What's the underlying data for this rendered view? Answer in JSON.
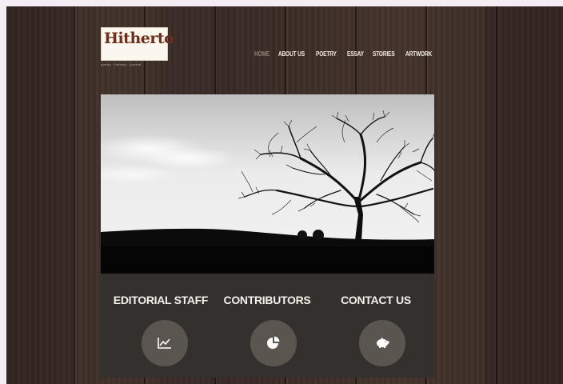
{
  "brand": {
    "logo_text": "Hitherto",
    "tagline": "poetry · literary · journal"
  },
  "nav": {
    "items": [
      "HOME",
      "ABOUT US",
      "POETRY",
      "ESSAY",
      "STORIES",
      "ARTWORK"
    ],
    "active": "HOME"
  },
  "hero": {
    "alt": "black and white silhouette of a bare tree on a hill"
  },
  "features": [
    {
      "title": "EDITORIAL STAFF",
      "icon": "chart-line-icon"
    },
    {
      "title": "CONTRIBUTORS",
      "icon": "pie-chart-icon"
    },
    {
      "title": "CONTACT US",
      "icon": "piggy-bank-icon"
    }
  ],
  "colors": {
    "wood": "#3d2e28",
    "panel": "#33302d",
    "circle": "#5b5550",
    "logo_red": "#6b2f1b",
    "active_nav": "#8e817a"
  }
}
